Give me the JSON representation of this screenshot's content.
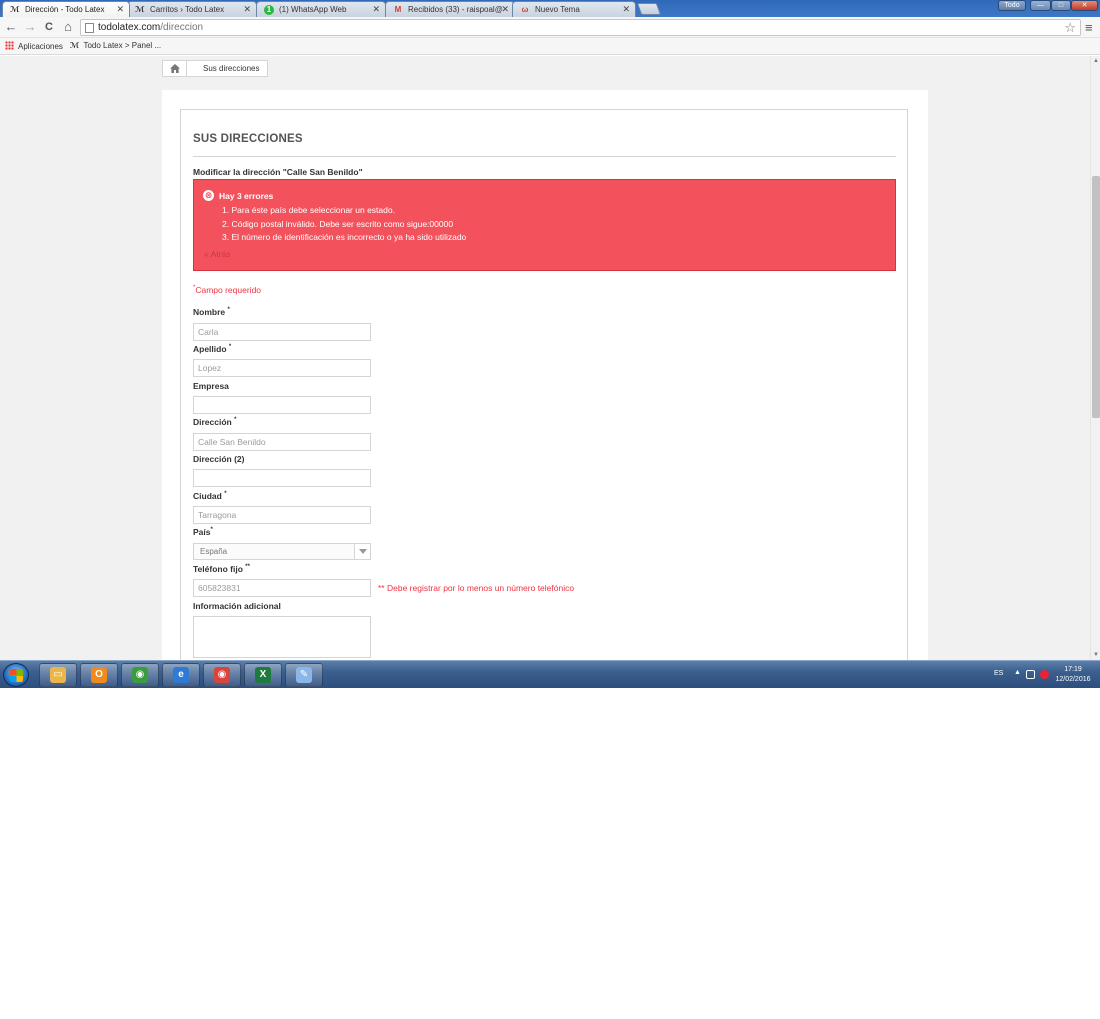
{
  "browser": {
    "tabs": [
      {
        "title": "Dirección - Todo Latex",
        "icon": "todolatex-icon",
        "active": true
      },
      {
        "title": "Carritos › Todo Latex",
        "icon": "todolatex-icon",
        "active": false
      },
      {
        "title": "(1) WhatsApp Web",
        "icon": "whatsapp-icon",
        "active": false
      },
      {
        "title": "Recibidos (33) - raispoal@",
        "icon": "gmail-icon",
        "active": false
      },
      {
        "title": "Nuevo Tema",
        "icon": "forum-icon",
        "active": false
      }
    ],
    "close_glyph": "✕",
    "profile_label": "Todo",
    "window_controls": {
      "minimize": "—",
      "maximize": "□",
      "close": "✕"
    },
    "nav": {
      "back": "←",
      "forward": "→",
      "reload": "C",
      "home": "⌂"
    },
    "url_host": "todolatex.com",
    "url_path": "/direccion",
    "star": "☆",
    "menu": "≡",
    "bookmarks": [
      {
        "label": "Aplicaciones",
        "icon": "apps-grid-icon"
      },
      {
        "label": "Todo Latex > Panel ...",
        "icon": "todolatex-icon"
      }
    ]
  },
  "page": {
    "breadcrumb": {
      "home_icon": "home-icon",
      "current": "Sus direcciones"
    },
    "title": "SUS DIRECCIONES",
    "modify_heading": "Modificar la dirección \"Calle San Benildo\"",
    "error": {
      "icon": "⊗",
      "title": "Hay 3 errores",
      "items": [
        "1. Para éste país debe seleccionar un estado.",
        "2. Código postal inválido. Debe ser escrito como sigue:00000",
        "3. El número de identificación es incorrecto o ya ha sido utilizado"
      ],
      "back_link": "« Atrás"
    },
    "required_note": {
      "star": "*",
      "text": "Campo requerido"
    },
    "form": {
      "nombre": {
        "label": "Nombre",
        "req": "*",
        "value": "Carla"
      },
      "apellido": {
        "label": "Apellido",
        "req": "*",
        "value": "Lopez"
      },
      "empresa": {
        "label": "Empresa",
        "value": ""
      },
      "direccion": {
        "label": "Dirección",
        "req": "*",
        "value": "Calle San Benildo"
      },
      "direccion2": {
        "label": "Dirección (2)",
        "value": ""
      },
      "ciudad": {
        "label": "Ciudad",
        "req": "*",
        "value": "Tarragona"
      },
      "pais": {
        "label": "País",
        "req": "*",
        "value": "España"
      },
      "telefono": {
        "label": "Teléfono fijo",
        "req": "**",
        "value": "605823831",
        "note": "** Debe registrar por lo menos un número telefónico"
      },
      "info": {
        "label": "Información adicional",
        "value": ""
      }
    },
    "colors": {
      "error_bg": "#f3515c",
      "error_text": "#f13340"
    }
  },
  "taskbar": {
    "apps": [
      {
        "name": "explorer-icon",
        "color": "#e8b64a",
        "glyph": "▭"
      },
      {
        "name": "outlook-icon",
        "color": "#f08a1c",
        "glyph": "O"
      },
      {
        "name": "chrome-icon",
        "color": "#3a9b3f",
        "glyph": "◉"
      },
      {
        "name": "internet-explorer-icon",
        "color": "#2e7bd6",
        "glyph": "e"
      },
      {
        "name": "chrome-icon",
        "color": "#d9453a",
        "glyph": "◉"
      },
      {
        "name": "excel-icon",
        "color": "#1e7a3e",
        "glyph": "X"
      },
      {
        "name": "paint-icon",
        "color": "#8ab6e8",
        "glyph": "✎"
      }
    ],
    "language": "ES",
    "time": "17:19",
    "date": "12/02/2016"
  }
}
